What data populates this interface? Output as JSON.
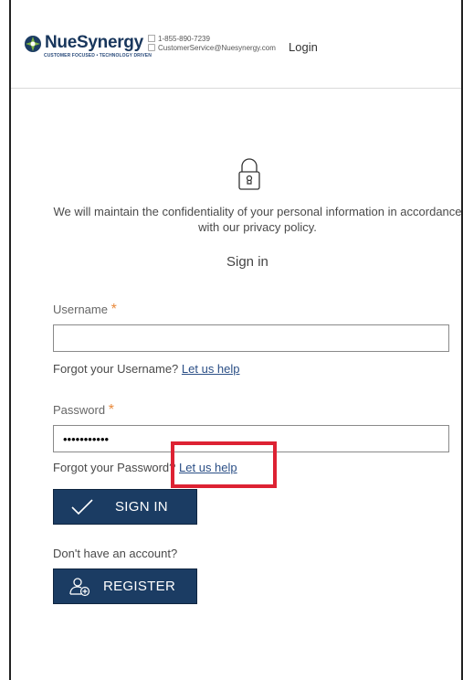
{
  "header": {
    "brand_name": "NueSynergy",
    "brand_tagline": "CUSTOMER FOCUSED • TECHNOLOGY DRIVEN",
    "phone": "1-855-890-7239",
    "email": "CustomerService@Nuesynergy.com",
    "login_label": "Login"
  },
  "main": {
    "privacy_notice": "We will maintain the confidentiality of your personal information in accordance with our privacy policy.",
    "title": "Sign in",
    "username_label": "Username",
    "username_value": "",
    "forgot_username_text": "Forgot your Username?",
    "forgot_username_link": "Let us help",
    "password_label": "Password",
    "password_value": "•••••••••••",
    "forgot_password_text": "Forgot your Password?",
    "forgot_password_link": "Let us help",
    "sign_in_button": "SIGN IN",
    "no_account_text": "Don't have an account?",
    "register_button": "REGISTER",
    "required_marker": "*"
  },
  "colors": {
    "primary": "#1b3c63",
    "required": "#e98a3c",
    "highlight": "#dd2233",
    "link": "#2b4f86"
  },
  "icons": [
    "nuesynergy-logo-icon",
    "phone-icon",
    "mail-icon",
    "lock-icon",
    "checkmark-icon",
    "add-user-icon"
  ]
}
